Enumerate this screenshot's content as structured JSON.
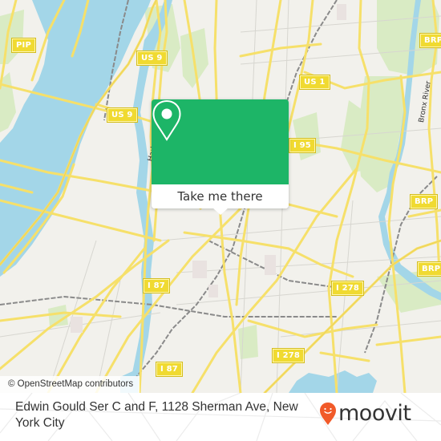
{
  "map": {
    "colors": {
      "land": "#f2f1ec",
      "water": "#a3d6e8",
      "park": "#d9ebc4",
      "road": "#f6e06a",
      "rail": "#8a8a8a",
      "shield_bg": "#f0da31"
    },
    "shields": [
      {
        "label": "PIP"
      },
      {
        "label": "US 9"
      },
      {
        "label": "US 9"
      },
      {
        "label": "US 1"
      },
      {
        "label": "I 95"
      },
      {
        "label": "BRP"
      },
      {
        "label": "BRP"
      },
      {
        "label": "BRP"
      },
      {
        "label": "I 87"
      },
      {
        "label": "I 87"
      },
      {
        "label": "I 278"
      },
      {
        "label": "I 278"
      }
    ],
    "labels": {
      "bronx_river": "Bronx River",
      "harlem_river": "Harlem River"
    },
    "attribution": "© OpenStreetMap contributors"
  },
  "popup": {
    "icon": "map-pin-icon",
    "button_label": "Take me there",
    "color": "#1db567"
  },
  "footer": {
    "address": "Edwin Gould Ser C and F, 1128 Sherman Ave, New York City",
    "logo_text": "moovit",
    "logo_color": "#f15a29"
  }
}
